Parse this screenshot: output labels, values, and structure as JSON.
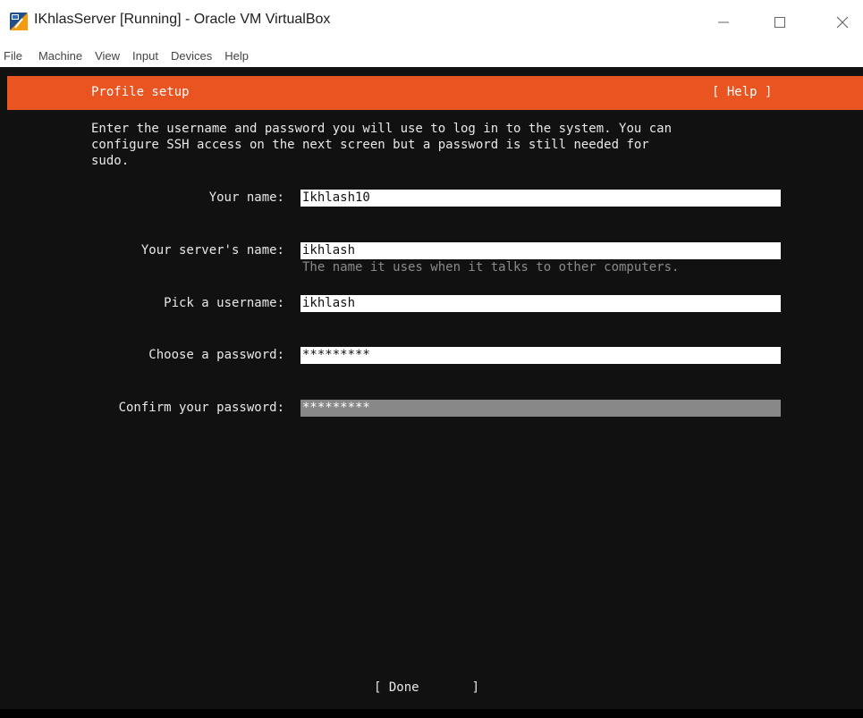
{
  "window": {
    "title": "IKhlasServer [Running] - Oracle VM VirtualBox",
    "icon": "virtualbox-icon",
    "controls": {
      "minimize": "—",
      "maximize": "☐",
      "close": "✕"
    }
  },
  "menu": {
    "items": [
      "File",
      "Machine",
      "View",
      "Input",
      "Devices",
      "Help"
    ]
  },
  "installer": {
    "header_title": "Profile setup",
    "help_label": "[ Help ]",
    "accent_color": "#e95420",
    "intro": "Enter the username and password you will use to log in to the system. You can\nconfigure SSH access on the next screen but a password is still needed for\nsudo.",
    "fields": [
      {
        "label": "Your name:",
        "value": "Ikhlash10"
      },
      {
        "label": "Your server's name:",
        "value": "ikhlash",
        "hint": "The name it uses when it talks to other computers."
      },
      {
        "label": "Pick a username:",
        "value": "ikhlash"
      },
      {
        "label": "Choose a password:",
        "value": "*********"
      },
      {
        "label": "Confirm your password:",
        "value": "*********"
      }
    ],
    "done_label": "[ Done       ]"
  }
}
